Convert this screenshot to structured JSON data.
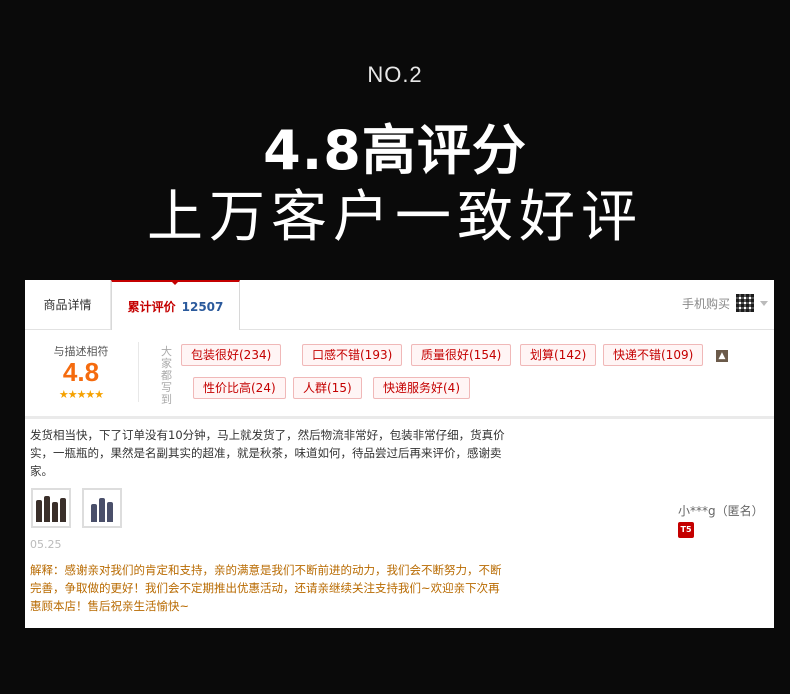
{
  "hero": {
    "no": "NO.2",
    "headline": "4.8高评分",
    "subhead": "上万客户一致好评"
  },
  "tabs": {
    "details": "商品详情",
    "reviews_label": "累计评价",
    "reviews_count": "12507",
    "mobile_buy": "手机购买"
  },
  "summary": {
    "match_label": "与描述相符",
    "score": "4.8",
    "stars": "★★★★★",
    "side_label": "大家都写到",
    "tags": [
      "包装很好(234)",
      "口感不错(193)",
      "质量很好(154)",
      "划算(142)",
      "快递不错(109)",
      "性价比高(24)",
      "人群(15)",
      "快递服务好(4)"
    ],
    "collapse_glyph": "▲"
  },
  "review": {
    "text": "发货相当快，下了订单没有10分钟，马上就发货了，然后物流非常好，包装非常仔细，货真价实，一瓶瓶的，果然是名副其实的超准，就是秋茶，味道如何，待品尝过后再来评价，感谢卖家。",
    "date": "05.25",
    "reply": "解释：感谢亲对我们的肯定和支持，亲的满意是我们不断前进的动力，我们会不断努力，不断完善，争取做的更好！我们会不定期推出优惠活动，还请亲继续关注支持我们~欢迎亲下次再惠顾本店！售后祝亲生活愉快~",
    "user": "小***g（匿名）",
    "vip_badge": "T5"
  },
  "colors": {
    "accent_red": "#c40000",
    "score_orange": "#f56b0e",
    "reply_brown": "#b86a00",
    "count_blue": "#2b5a9c"
  }
}
